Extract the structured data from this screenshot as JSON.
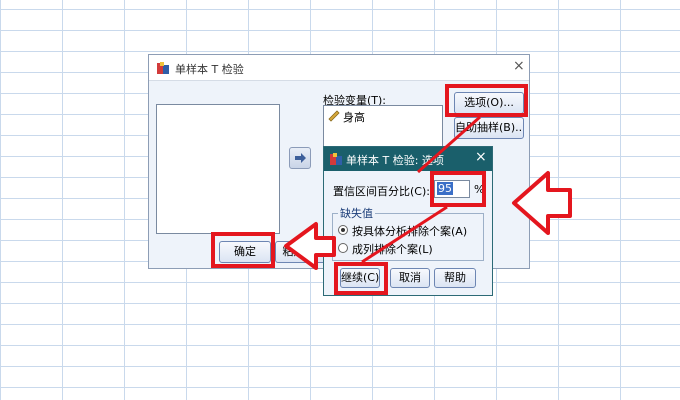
{
  "main_dialog": {
    "title": "单样本 T 检验",
    "close_label": "×",
    "test_vars_label": "检验变量(T):",
    "test_vars_items": [
      "身高"
    ],
    "options_button": "选项(O)...",
    "bootstrap_button": "自助抽样(B)...",
    "ok_button": "确定",
    "paste_button": "粘贴(P)"
  },
  "options_dialog": {
    "title": "单样本 T 检验: 选项",
    "close_label": "×",
    "ci_label": "置信区间百分比(C):",
    "ci_value": "95",
    "percent_sign": "%",
    "missing_group_label": "缺失值",
    "missing_options": [
      {
        "label": "按具体分析排除个案(A)",
        "selected": true
      },
      {
        "label": "成列排除个案(L)",
        "selected": false
      }
    ],
    "continue_button": "继续(C)",
    "cancel_button": "取消",
    "help_button": "帮助"
  },
  "colors": {
    "annotation_red": "#e4161e",
    "options_titlebar": "#1a5f6b",
    "dialog_bg": "#eef3fa"
  }
}
